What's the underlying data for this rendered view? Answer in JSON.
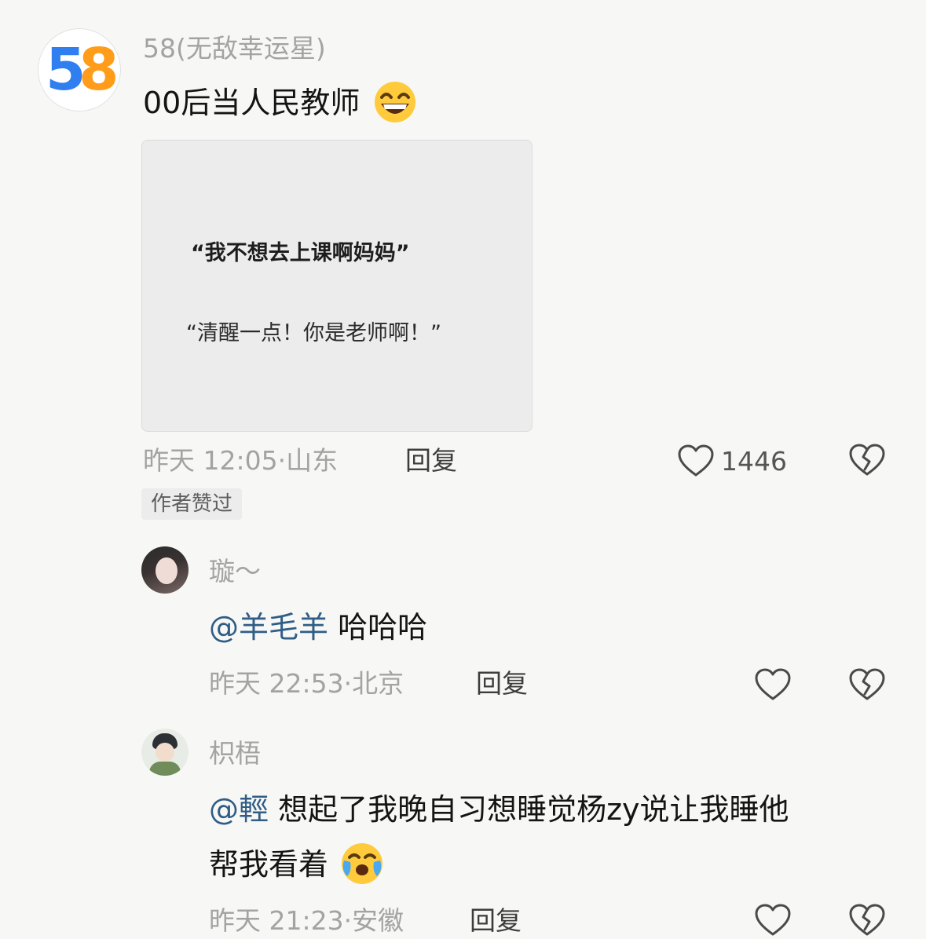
{
  "main_comment": {
    "username": "58(无敌幸运星)",
    "text": "00后当人民教师",
    "avatar_digits": [
      "5",
      "8"
    ],
    "image": {
      "line1": "“我不想去上课啊妈妈”",
      "line2": "“清醒一点！你是老师啊！”"
    },
    "time": "昨天 12:05",
    "location": "山东",
    "reply_label": "回复",
    "like_count": "1446",
    "author_liked": "作者赞过"
  },
  "replies": [
    {
      "username": "璇～",
      "mention": "@羊毛羊",
      "text": "哈哈哈",
      "time": "昨天 22:53",
      "location": "北京",
      "reply_label": "回复"
    },
    {
      "username": "枳梧",
      "mention": "@輕",
      "text_line1": "想起了我晚自习想睡觉杨zy说让我睡他",
      "text_line2": "帮我看着",
      "time": "昨天 21:23",
      "location": "安徽",
      "reply_label": "回复"
    }
  ],
  "icons": {
    "like": "heart-outline-icon",
    "dislike": "broken-heart-icon",
    "emoji_main": "grinning-face-emoji",
    "emoji_reply": "crying-laughing-face-emoji"
  },
  "colors": {
    "background": "#f7f7f5",
    "muted_text": "#a3a3a3",
    "mention": "#2f5d86",
    "badge_bg": "#ececec",
    "logo_blue": "#2f7ff0",
    "logo_red": "#f04040",
    "logo_green": "#3cc264",
    "logo_orange": "#ff9c1a"
  }
}
